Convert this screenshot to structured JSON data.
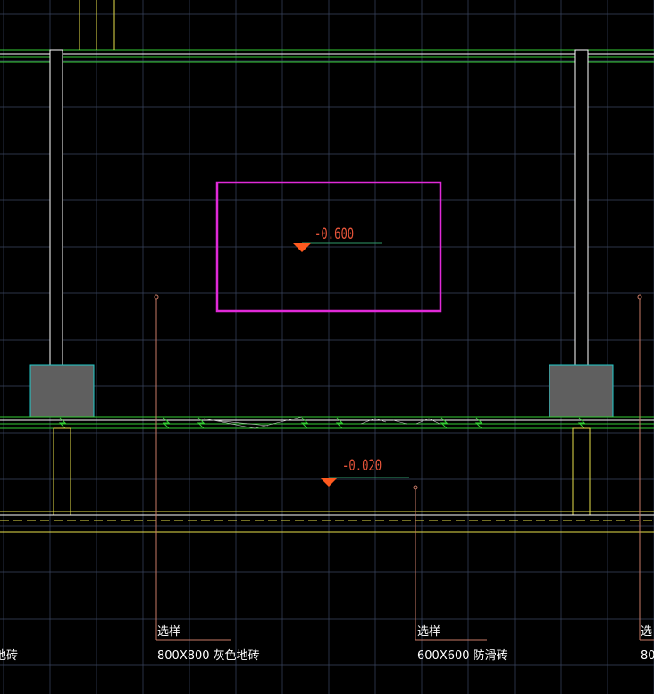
{
  "colors": {
    "background": "#000000",
    "grid": "#3a4660",
    "wall_outline": "#ffffff",
    "beam_line": "#33cc33",
    "column_fill": "#5f5f5f",
    "column_outline": "#22cccc",
    "footing_outline": "#e8e04a",
    "highlight": "#e02ad8",
    "elevation_text": "#e8553a",
    "elevation_marker": "#ff5a1f",
    "elevation_leader": "#2f9a6a",
    "leader_line": "#c77a66",
    "label_text": "#ffffff"
  },
  "elevations": {
    "upper": {
      "value": "-0.600"
    },
    "lower": {
      "value": "-0.020"
    }
  },
  "callouts": [
    {
      "key": "left_edge",
      "line1": "",
      "line2": "地砖"
    },
    {
      "key": "center_left",
      "line1": "选样",
      "line2": "800X800  灰色地砖"
    },
    {
      "key": "center_right",
      "line1": "选样",
      "line2": "600X600  防滑砖"
    },
    {
      "key": "right_edge",
      "line1": "选",
      "line2": "80"
    }
  ]
}
